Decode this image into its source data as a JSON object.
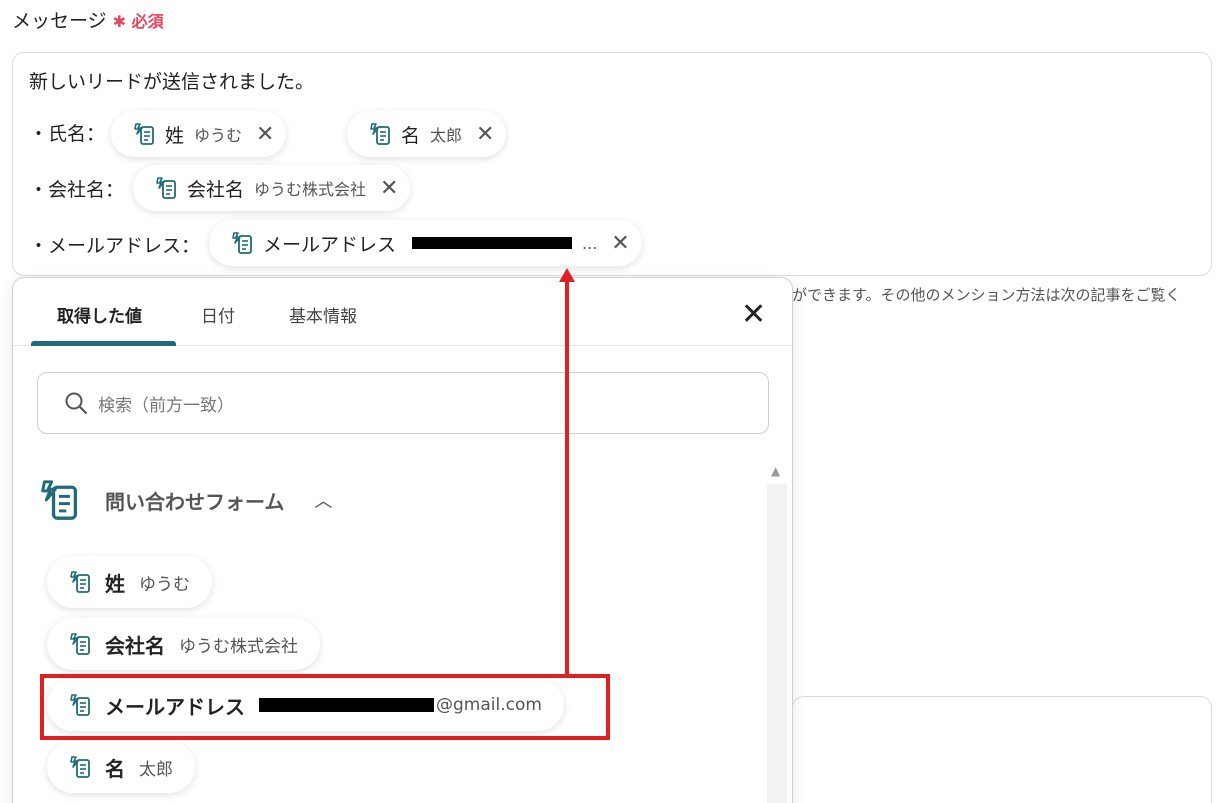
{
  "field": {
    "label": "メッセージ",
    "required": "必須",
    "required_mark": "✱"
  },
  "message": {
    "line1": "新しいリードが送信されました。",
    "lines": [
      {
        "label": "・氏名："
      },
      {
        "label": "・会社名："
      },
      {
        "label": "・メールアドレス："
      }
    ],
    "chips": {
      "last_name": {
        "name": "姓",
        "value": "ゆうむ"
      },
      "first_name": {
        "name": "名",
        "value": "太郎"
      },
      "company": {
        "name": "会社名",
        "value": "ゆうむ株式会社"
      },
      "email": {
        "name": "メールアドレス",
        "value": "..."
      }
    }
  },
  "helper_text": "ができます。その他のメンション方法は次の記事をご覧く",
  "panel": {
    "tabs": [
      "取得した値",
      "日付",
      "基本情報"
    ],
    "active_tab": 0,
    "search_placeholder": "検索（前方一致）",
    "group": {
      "name": "問い合わせフォーム"
    },
    "items": [
      {
        "name": "姓",
        "value": "ゆうむ"
      },
      {
        "name": "会社名",
        "value": "ゆうむ株式会社"
      },
      {
        "name": "メールアドレス",
        "value_suffix": "@gmail.com"
      },
      {
        "name": "名",
        "value": "太郎"
      }
    ]
  },
  "colors": {
    "required": "#e4455f",
    "tab_underline": "#1f6b7a",
    "highlight": "#e02020",
    "icon": "#1f6b7a"
  },
  "icons": {
    "field": "form-doc-icon",
    "close": "close-icon",
    "search": "search-icon",
    "chevron": "chevron-up-icon"
  }
}
